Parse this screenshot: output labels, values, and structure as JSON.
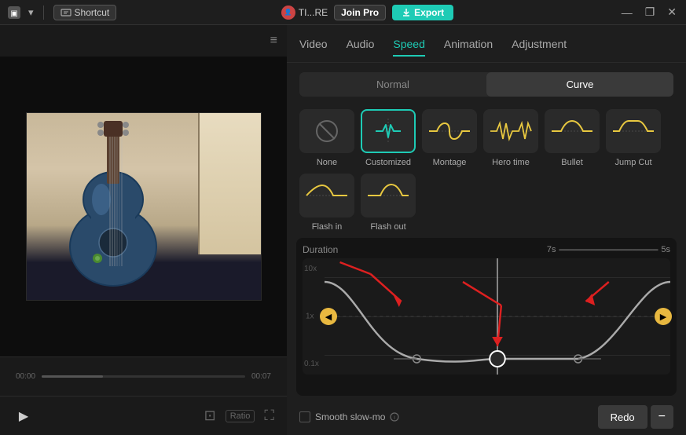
{
  "titleBar": {
    "shortcutLabel": "Shortcut",
    "userLabel": "TI...RE",
    "joinProLabel": "Join Pro",
    "exportLabel": "Export",
    "windowBtns": [
      "—",
      "❐",
      "✕"
    ]
  },
  "tabs": {
    "items": [
      {
        "label": "Video",
        "active": false
      },
      {
        "label": "Audio",
        "active": false
      },
      {
        "label": "Speed",
        "active": true
      },
      {
        "label": "Animation",
        "active": false
      },
      {
        "label": "Adjustment",
        "active": false
      }
    ]
  },
  "speedMode": {
    "normal": "Normal",
    "curve": "Curve"
  },
  "speedOptions": [
    {
      "label": "None",
      "type": "none"
    },
    {
      "label": "Customized",
      "type": "customized",
      "active": true
    },
    {
      "label": "Montage",
      "type": "montage"
    },
    {
      "label": "Hero time",
      "type": "hero"
    },
    {
      "label": "Bullet",
      "type": "bullet"
    },
    {
      "label": "Jump Cut",
      "type": "jumpcut"
    },
    {
      "label": "Flash in",
      "type": "flashin"
    },
    {
      "label": "Flash out",
      "type": "flashout"
    }
  ],
  "duration": {
    "label": "Duration",
    "start": "7s",
    "end": "5s"
  },
  "yLabels": [
    "10x",
    "1x",
    "0.1x"
  ],
  "buttons": {
    "redo": "Redo",
    "minus": "−",
    "smoothLabel": "Smooth slow-mo"
  },
  "hamburger": "≡",
  "playIcon": "▶"
}
